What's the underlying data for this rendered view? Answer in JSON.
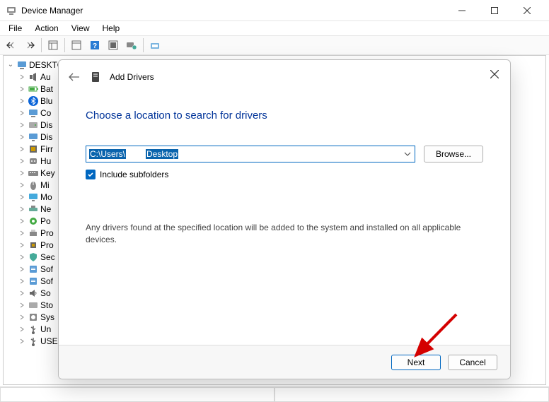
{
  "window": {
    "title": "Device Manager"
  },
  "menu": {
    "file": "File",
    "action": "Action",
    "view": "View",
    "help": "Help"
  },
  "tree": {
    "root": "DESKTO",
    "items": [
      {
        "label": "Au",
        "icon": "audio"
      },
      {
        "label": "Bat",
        "icon": "battery"
      },
      {
        "label": "Blu",
        "icon": "bluetooth"
      },
      {
        "label": "Co",
        "icon": "computer"
      },
      {
        "label": "Dis",
        "icon": "disk"
      },
      {
        "label": "Dis",
        "icon": "display"
      },
      {
        "label": "Firr",
        "icon": "firmware"
      },
      {
        "label": "Hu",
        "icon": "hid"
      },
      {
        "label": "Key",
        "icon": "keyboard"
      },
      {
        "label": "Mi",
        "icon": "mouse"
      },
      {
        "label": "Mo",
        "icon": "monitor"
      },
      {
        "label": "Ne",
        "icon": "network"
      },
      {
        "label": "Po",
        "icon": "port"
      },
      {
        "label": "Pro",
        "icon": "printqueue"
      },
      {
        "label": "Pro",
        "icon": "processor"
      },
      {
        "label": "Sec",
        "icon": "security"
      },
      {
        "label": "Sof",
        "icon": "software"
      },
      {
        "label": "Sof",
        "icon": "software"
      },
      {
        "label": "So",
        "icon": "sound"
      },
      {
        "label": "Sto",
        "icon": "storage"
      },
      {
        "label": "Sys",
        "icon": "system"
      },
      {
        "label": "Un",
        "icon": "usb"
      },
      {
        "label": "USE",
        "icon": "usb"
      }
    ]
  },
  "dialog": {
    "title": "Add Drivers",
    "heading": "Choose a location to search for drivers",
    "path_prefix": "C:\\Users\\",
    "path_mid": "",
    "path_suffix": "Desktop",
    "browse": "Browse...",
    "include_subfolders": "Include subfolders",
    "include_checked": true,
    "info": "Any drivers found at the specified location will be added to the system and installed on all applicable devices.",
    "next": "Next",
    "cancel": "Cancel"
  }
}
